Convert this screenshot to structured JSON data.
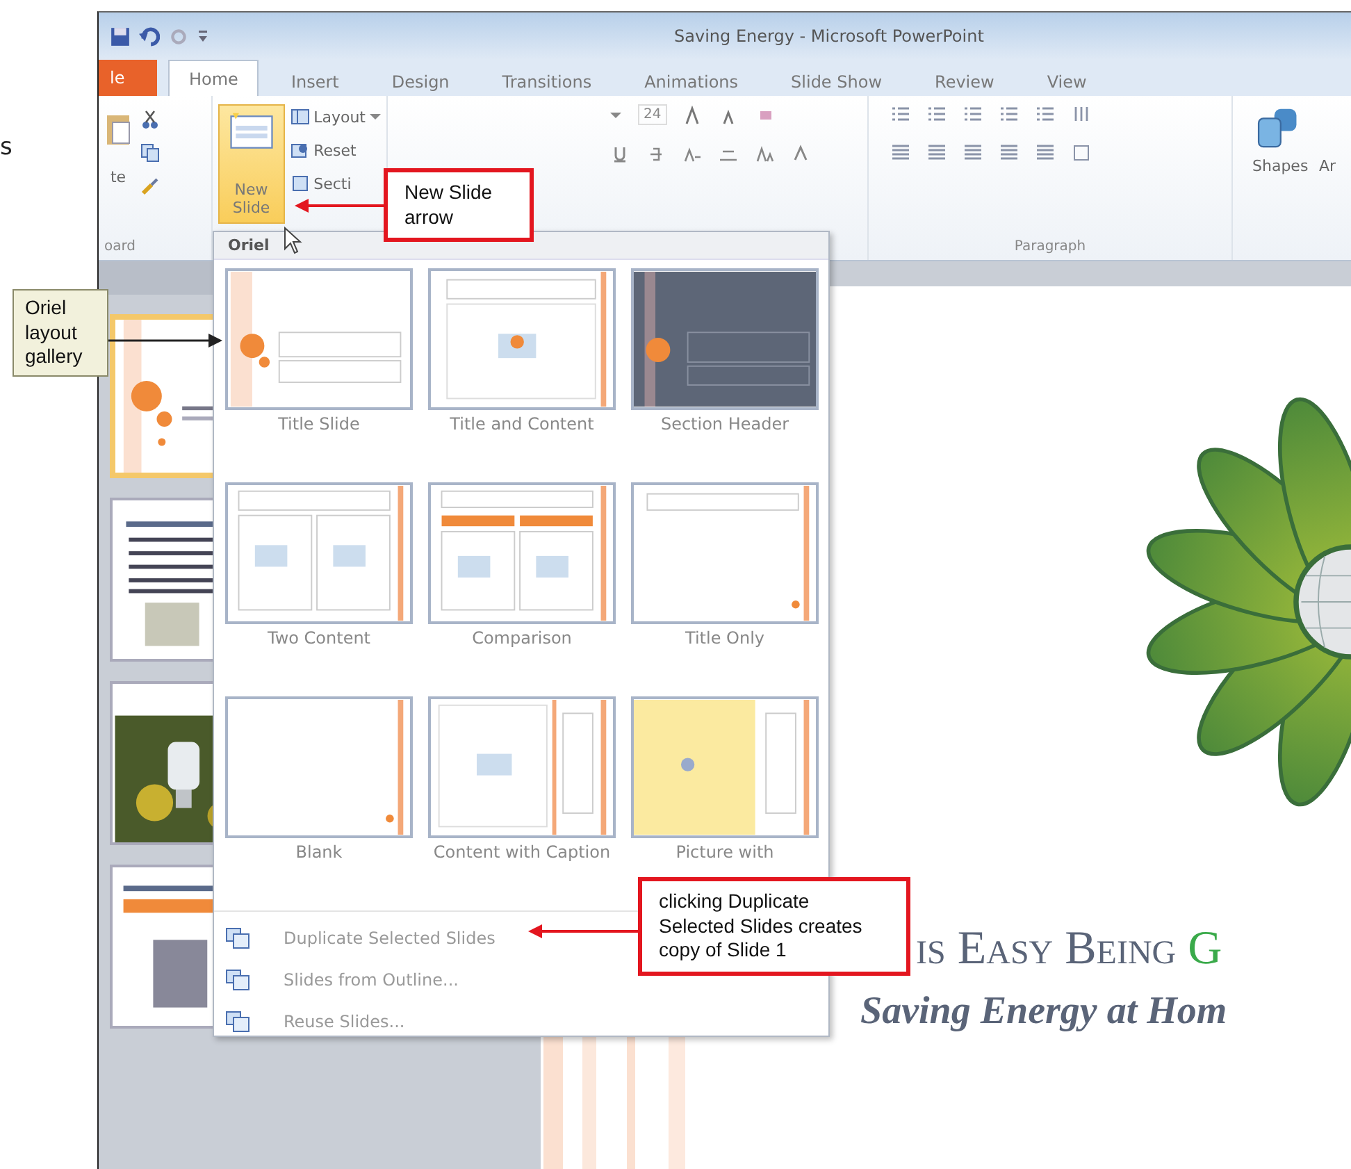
{
  "page_text": "s",
  "window": {
    "title": "Saving Energy - Microsoft PowerPoint"
  },
  "tabs": [
    {
      "label": "le",
      "kind": "file",
      "selected": false
    },
    {
      "label": "Home",
      "kind": "tab",
      "selected": true
    },
    {
      "label": "Insert",
      "kind": "tab",
      "selected": false
    },
    {
      "label": "Design",
      "kind": "tab",
      "selected": false
    },
    {
      "label": "Transitions",
      "kind": "tab",
      "selected": false
    },
    {
      "label": "Animations",
      "kind": "tab",
      "selected": false
    },
    {
      "label": "Slide Show",
      "kind": "tab",
      "selected": false
    },
    {
      "label": "Review",
      "kind": "tab",
      "selected": false
    },
    {
      "label": "View",
      "kind": "tab",
      "selected": false
    }
  ],
  "ribbon": {
    "clipboard": {
      "paste_label": "te",
      "group_label": "oard"
    },
    "slides": {
      "new_slide_label": "New Slide",
      "new_slide_active": true,
      "layout": "Layout",
      "reset": "Reset",
      "section": "Secti"
    },
    "font": {
      "size": "24"
    },
    "paragraph": {
      "group_label": "Paragraph"
    },
    "drawing": {
      "shapes": "Shapes",
      "arrange": "Ar"
    }
  },
  "slides_pane": {
    "thumbnails": [
      {
        "kind": "title",
        "selected": true
      },
      {
        "kind": "bullets",
        "selected": false
      },
      {
        "kind": "picture",
        "selected": false
      },
      {
        "kind": "diagram",
        "selected": false
      }
    ]
  },
  "layout_menu": {
    "header": "Oriel",
    "layouts": [
      {
        "label": "Title Slide",
        "kind": "title"
      },
      {
        "label": "Title and Content",
        "kind": "title-content"
      },
      {
        "label": "Section Header",
        "kind": "section"
      },
      {
        "label": "Two Content",
        "kind": "two"
      },
      {
        "label": "Comparison",
        "kind": "comparison"
      },
      {
        "label": "Title Only",
        "kind": "title-only"
      },
      {
        "label": "Blank",
        "kind": "blank"
      },
      {
        "label": "Content with Caption",
        "kind": "content-caption"
      },
      {
        "label": "Picture with",
        "kind": "picture-caption"
      }
    ],
    "commands": [
      {
        "label": "Duplicate Selected Slides"
      },
      {
        "label": "Slides from Outline..."
      },
      {
        "label": "Reuse Slides..."
      }
    ]
  },
  "slide": {
    "title": "is Easy Being",
    "title_accent": "G",
    "subtitle": "Saving Energy at Hom"
  },
  "callouts": [
    {
      "text": "New Slide arrow",
      "kind": "red"
    },
    {
      "text": "Oriel layout gallery",
      "kind": "tan"
    },
    {
      "text": "clicking Duplicate Selected Slides creates copy of Slide 1",
      "kind": "red"
    }
  ]
}
